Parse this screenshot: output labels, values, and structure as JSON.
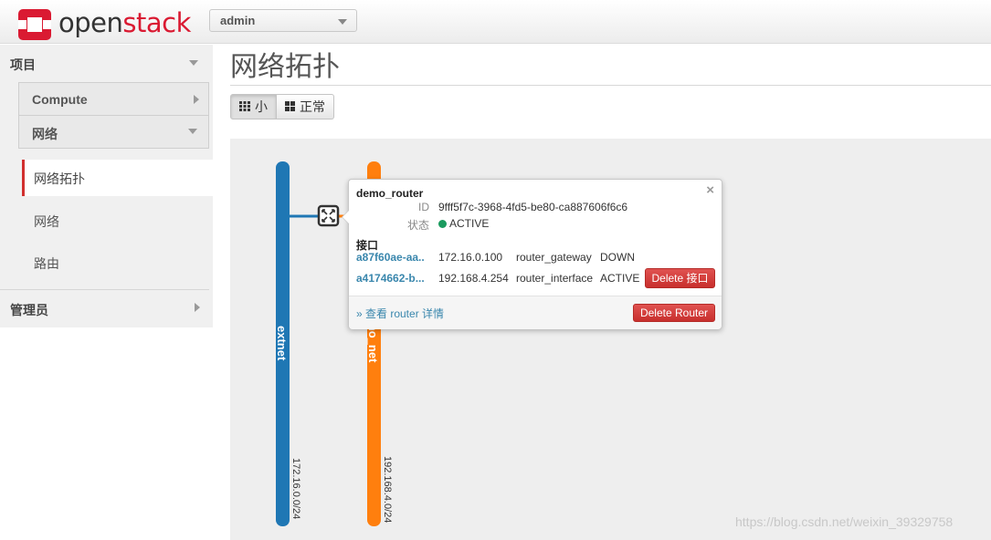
{
  "header": {
    "logo_part1": "open",
    "logo_part2": "stack",
    "project_selector": "admin"
  },
  "sidebar": {
    "project_label": "项目",
    "compute_label": "Compute",
    "network_label": "网络",
    "items": [
      {
        "label": "网络拓扑",
        "active": true
      },
      {
        "label": "网络",
        "active": false
      },
      {
        "label": "路由",
        "active": false
      }
    ],
    "admin_label": "管理员"
  },
  "main": {
    "title": "网络拓扑",
    "view_buttons": {
      "small": "小",
      "normal": "正常"
    }
  },
  "topology": {
    "networks": [
      {
        "name": "extnet",
        "cidr": "172.16.0.0/24",
        "color": "#1f77b4"
      },
      {
        "name": "demo_net",
        "cidr": "192.168.4.0/24",
        "color": "#ff7f0e"
      }
    ]
  },
  "router_popup": {
    "name": "demo_router",
    "id_label": "ID",
    "id_value": "9fff5f7c-3968-4fd5-be80-ca887606f6c6",
    "status_label": "状态",
    "status_value": "ACTIVE",
    "status_color": "#1a9a5e",
    "close_symbol": "×",
    "interfaces_heading": "接口",
    "interfaces": [
      {
        "port": "a87f60ae-aa..",
        "ip": "172.16.0.100",
        "type": "router_gateway",
        "status": "DOWN",
        "action": ""
      },
      {
        "port": "a4174662-b...",
        "ip": "192.168.4.254",
        "type": "router_interface",
        "status": "ACTIVE",
        "action": "Delete 接口"
      }
    ],
    "details_link": "» 查看 router 详情",
    "delete_router_label": "Delete Router"
  },
  "watermark": "https://blog.csdn.net/weixin_39329758"
}
